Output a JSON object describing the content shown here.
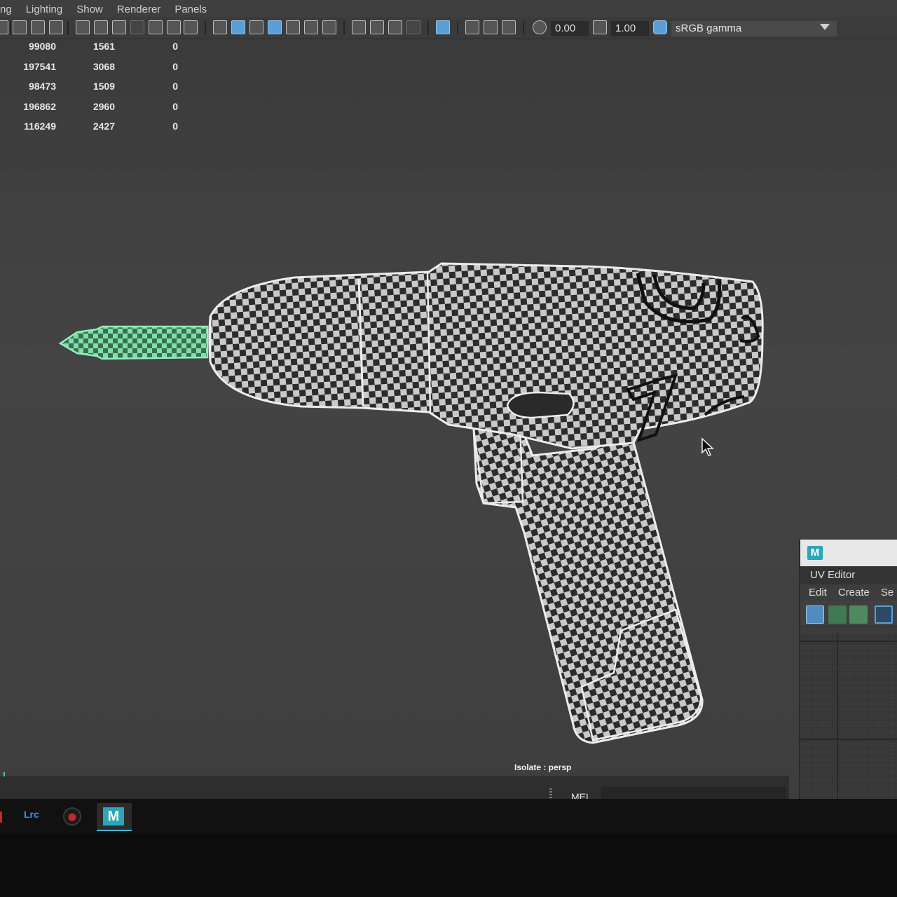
{
  "menu": {
    "items": [
      "ng",
      "Lighting",
      "Show",
      "Renderer",
      "Panels"
    ]
  },
  "toolbar": {
    "exposure_value": "0.00",
    "gamma_value": "1.00",
    "color_space": "sRGB gamma"
  },
  "hud": {
    "rows": [
      [
        "99080",
        "1561",
        "0"
      ],
      [
        "197541",
        "3068",
        "0"
      ],
      [
        "98473",
        "1509",
        "0"
      ],
      [
        "196862",
        "2960",
        "0"
      ],
      [
        "116249",
        "2427",
        "0"
      ]
    ]
  },
  "viewport": {
    "camera_label": "Isolate : persp"
  },
  "uv_editor": {
    "title": "UV Editor",
    "menu": [
      "Edit",
      "Create",
      "Se"
    ]
  },
  "command_line": {
    "label": "MEL"
  },
  "taskbar": {
    "lrc_label": "Lrc",
    "maya_label": "M"
  },
  "colors": {
    "accent_blue": "#5b9fd6",
    "bit_green": "#4fd08a",
    "maya_teal": "#2aa6b8"
  }
}
